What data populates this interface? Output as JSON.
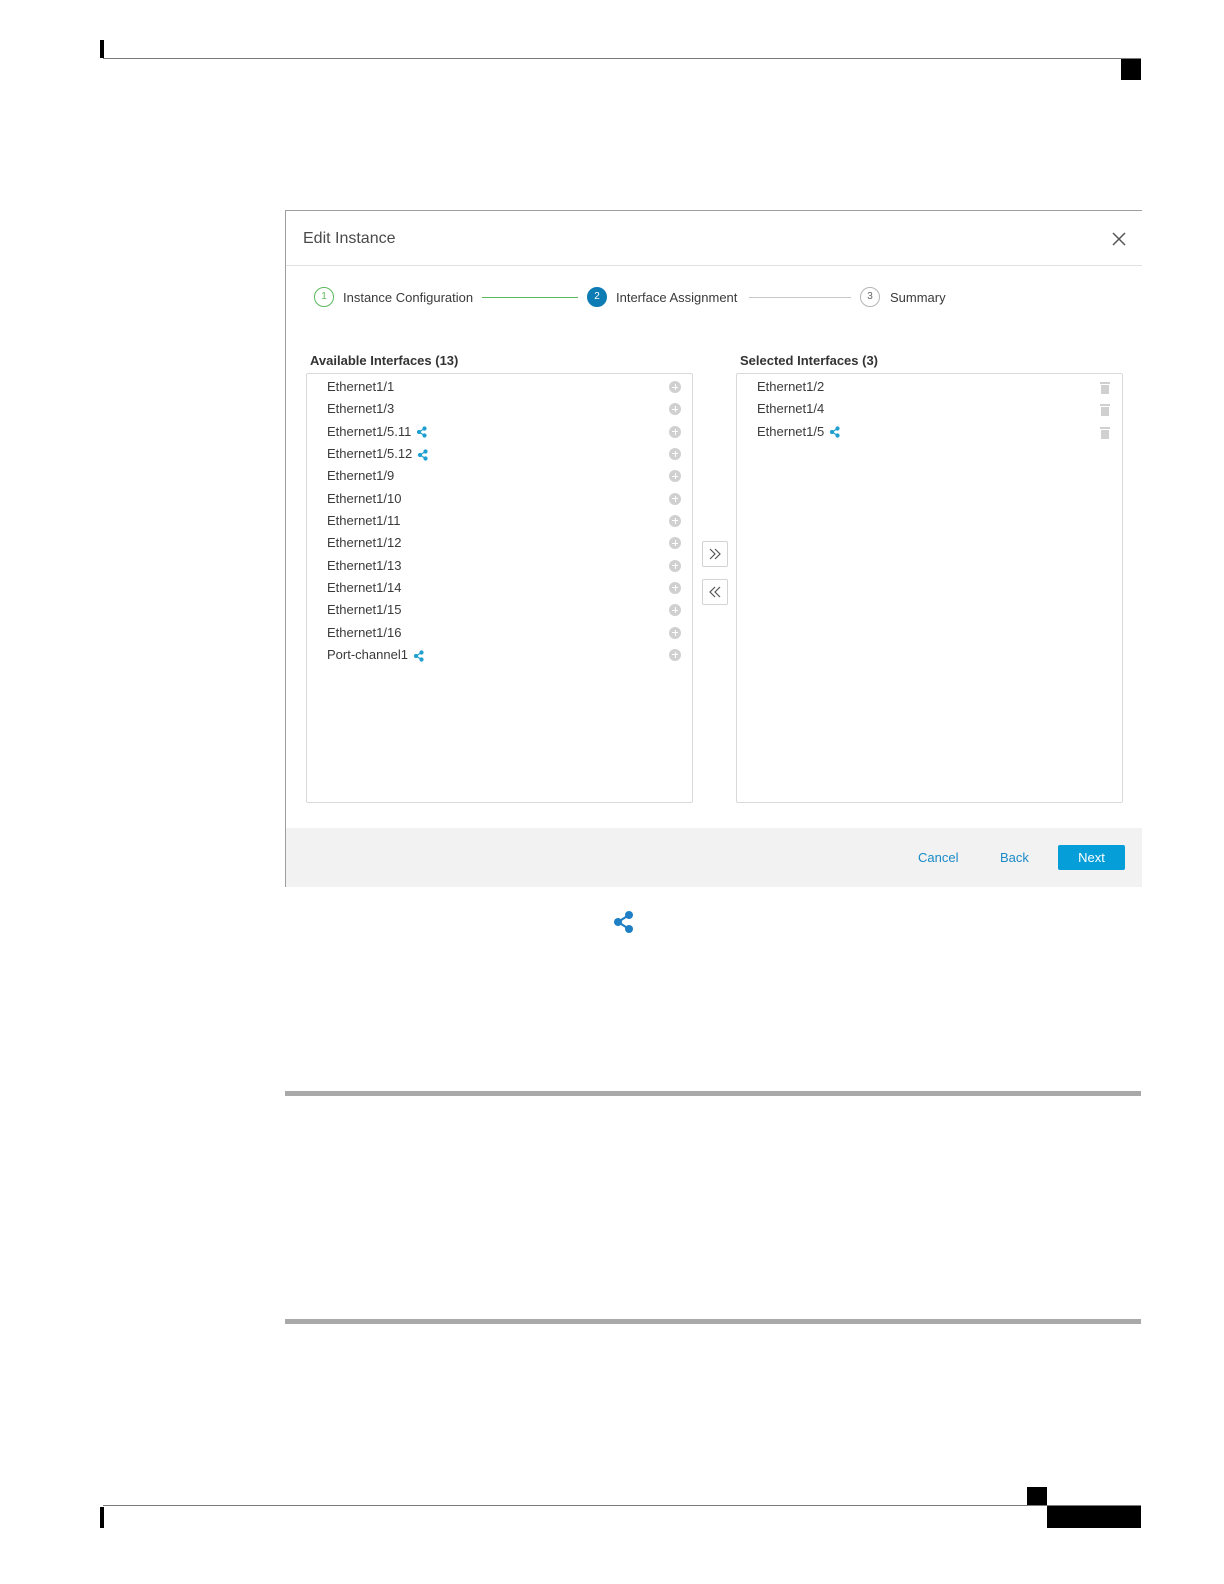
{
  "dialog": {
    "title": "Edit Instance",
    "close_icon": "close-icon"
  },
  "stepper": {
    "steps": [
      {
        "number": "1",
        "label": "Instance Configuration",
        "state": "complete"
      },
      {
        "number": "2",
        "label": "Interface Assignment",
        "state": "active"
      },
      {
        "number": "3",
        "label": "Summary",
        "state": "pending"
      }
    ]
  },
  "available": {
    "heading": "Available Interfaces (13)",
    "action_icon": "add-circle-icon",
    "items": [
      {
        "label": "Ethernet1/1",
        "shared": false
      },
      {
        "label": "Ethernet1/3",
        "shared": false
      },
      {
        "label": "Ethernet1/5.11",
        "shared": true
      },
      {
        "label": "Ethernet1/5.12",
        "shared": true
      },
      {
        "label": "Ethernet1/9",
        "shared": false
      },
      {
        "label": "Ethernet1/10",
        "shared": false
      },
      {
        "label": "Ethernet1/11",
        "shared": false
      },
      {
        "label": "Ethernet1/12",
        "shared": false
      },
      {
        "label": "Ethernet1/13",
        "shared": false
      },
      {
        "label": "Ethernet1/14",
        "shared": false
      },
      {
        "label": "Ethernet1/15",
        "shared": false
      },
      {
        "label": "Ethernet1/16",
        "shared": false
      },
      {
        "label": "Port-channel1",
        "shared": true
      }
    ]
  },
  "selected": {
    "heading": "Selected Interfaces (3)",
    "action_icon": "trash-icon",
    "items": [
      {
        "label": "Ethernet1/2",
        "shared": false
      },
      {
        "label": "Ethernet1/4",
        "shared": false
      },
      {
        "label": "Ethernet1/5",
        "shared": true
      }
    ]
  },
  "transfer": {
    "add_all_icon": "double-chevron-right-icon",
    "remove_all_icon": "double-chevron-left-icon"
  },
  "footer": {
    "cancel_label": "Cancel",
    "back_label": "Back",
    "next_label": "Next"
  },
  "legend": {
    "shared_icon": "share-icon"
  },
  "colors": {
    "accent": "#069ed9",
    "step_active": "#0d7cb4",
    "step_complete": "#5cb85c",
    "share_icon": "#1f9fd0",
    "link": "#1a8ac6"
  }
}
